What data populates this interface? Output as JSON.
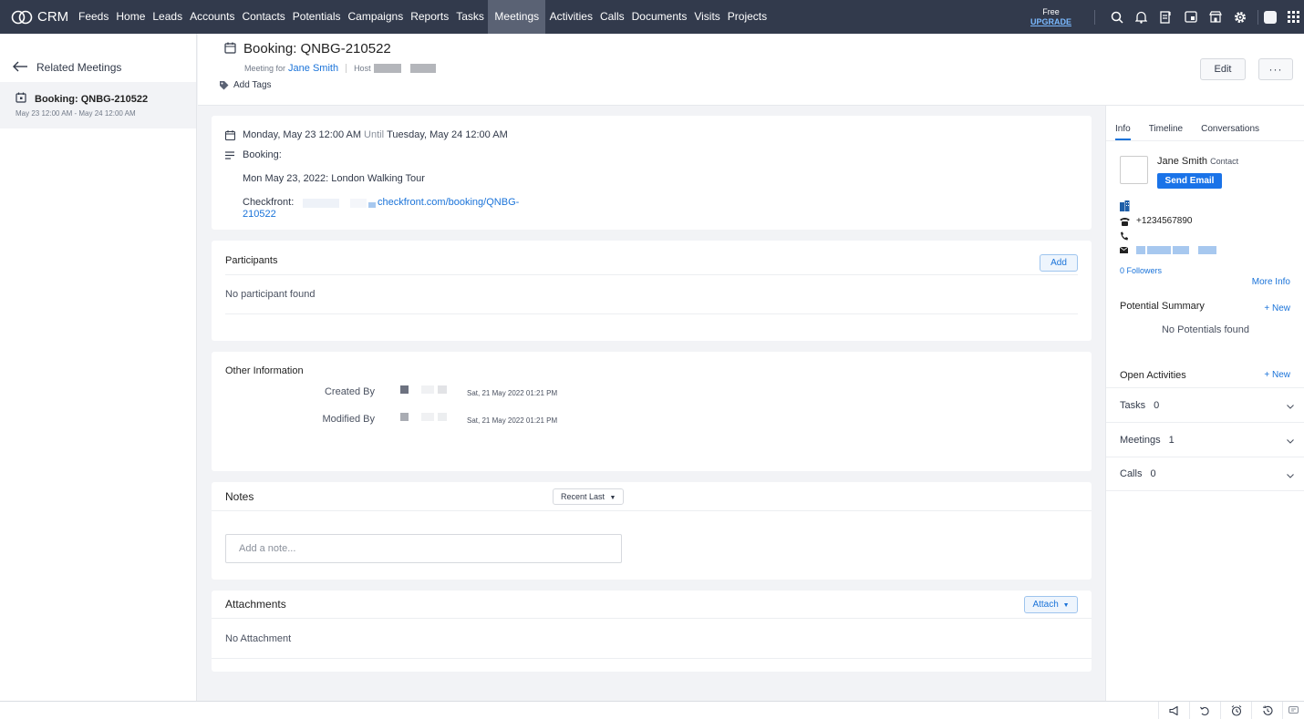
{
  "app": {
    "logo_text": "CRM"
  },
  "nav": {
    "items": [
      "Feeds",
      "Home",
      "Leads",
      "Accounts",
      "Contacts",
      "Potentials",
      "Campaigns",
      "Reports",
      "Tasks",
      "Meetings",
      "Activities",
      "Calls",
      "Documents",
      "Visits",
      "Projects"
    ],
    "active": "Meetings"
  },
  "plan": {
    "label": "Free",
    "upgrade": "UPGRADE"
  },
  "top_icons": [
    "search-icon",
    "bell-icon",
    "add-note-icon",
    "calendar-widget-icon",
    "store-icon",
    "gear-icon",
    "avatar",
    "apps-grid-icon"
  ],
  "left_panel": {
    "title": "Related Meetings",
    "items": [
      {
        "name": "Booking: QNBG-210522",
        "date": "May 23 12:00 AM - May 24 12:00 AM"
      }
    ]
  },
  "header": {
    "title": "Booking: QNBG-210522",
    "meeting_for_label": "Meeting for",
    "meeting_for_value": "Jane Smith",
    "host_label": "Host",
    "add_tags": "Add Tags",
    "edit": "Edit",
    "more": "···"
  },
  "details": {
    "start": "Monday, May 23 12:00 AM",
    "until_label": "Until",
    "end": "Tuesday, May 24 12:00 AM",
    "desc_label": "Booking:",
    "desc_line": "Mon May 23, 2022: London Walking Tour",
    "checkfront_label": "Checkfront:",
    "checkfront_link_1": "checkfront.com/booking/QNBG-",
    "checkfront_link_2": "210522"
  },
  "participants": {
    "title": "Participants",
    "add": "Add",
    "empty": "No participant found"
  },
  "other_info": {
    "title": "Other Information",
    "created_label": "Created By",
    "created_date": "Sat, 21 May 2022 01:21 PM",
    "modified_label": "Modified By",
    "modified_date": "Sat, 21 May 2022 01:21 PM"
  },
  "notes": {
    "title": "Notes",
    "sort": "Recent Last",
    "placeholder": "Add a note..."
  },
  "attachments": {
    "title": "Attachments",
    "attach": "Attach",
    "empty": "No Attachment"
  },
  "right_panel": {
    "tabs": [
      "Info",
      "Timeline",
      "Conversations"
    ],
    "active_tab": "Info",
    "contact_name": "Jane Smith",
    "contact_type": "Contact",
    "send_email": "Send Email",
    "phone": "+1234567890",
    "followers": "0 Followers",
    "more_info": "More Info",
    "potential_summary": "Potential Summary",
    "new_label": "+ New",
    "no_potentials": "No Potentials found",
    "open_activities": "Open Activities",
    "activities": [
      {
        "label": "Tasks",
        "count": "0"
      },
      {
        "label": "Meetings",
        "count": "1"
      },
      {
        "label": "Calls",
        "count": "0"
      }
    ]
  },
  "bottom_icons": [
    "announcement-icon",
    "sync-icon",
    "alarm-icon",
    "history-icon",
    "chat-icon"
  ],
  "colors": {
    "topbar": "#323a4c",
    "accent": "#1a73d9",
    "background": "#f2f3f6"
  }
}
